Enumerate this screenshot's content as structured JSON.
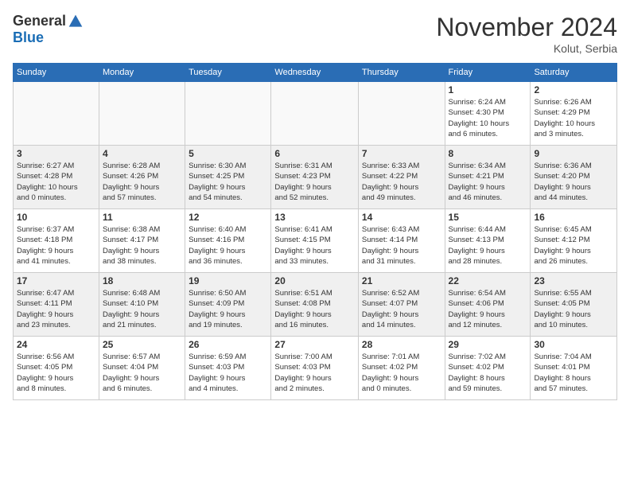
{
  "header": {
    "logo_general": "General",
    "logo_blue": "Blue",
    "month_title": "November 2024",
    "location": "Kolut, Serbia"
  },
  "weekdays": [
    "Sunday",
    "Monday",
    "Tuesday",
    "Wednesday",
    "Thursday",
    "Friday",
    "Saturday"
  ],
  "weeks": [
    {
      "alt": false,
      "days": [
        {
          "num": "",
          "info": ""
        },
        {
          "num": "",
          "info": ""
        },
        {
          "num": "",
          "info": ""
        },
        {
          "num": "",
          "info": ""
        },
        {
          "num": "",
          "info": ""
        },
        {
          "num": "1",
          "info": "Sunrise: 6:24 AM\nSunset: 4:30 PM\nDaylight: 10 hours\nand 6 minutes."
        },
        {
          "num": "2",
          "info": "Sunrise: 6:26 AM\nSunset: 4:29 PM\nDaylight: 10 hours\nand 3 minutes."
        }
      ]
    },
    {
      "alt": true,
      "days": [
        {
          "num": "3",
          "info": "Sunrise: 6:27 AM\nSunset: 4:28 PM\nDaylight: 10 hours\nand 0 minutes."
        },
        {
          "num": "4",
          "info": "Sunrise: 6:28 AM\nSunset: 4:26 PM\nDaylight: 9 hours\nand 57 minutes."
        },
        {
          "num": "5",
          "info": "Sunrise: 6:30 AM\nSunset: 4:25 PM\nDaylight: 9 hours\nand 54 minutes."
        },
        {
          "num": "6",
          "info": "Sunrise: 6:31 AM\nSunset: 4:23 PM\nDaylight: 9 hours\nand 52 minutes."
        },
        {
          "num": "7",
          "info": "Sunrise: 6:33 AM\nSunset: 4:22 PM\nDaylight: 9 hours\nand 49 minutes."
        },
        {
          "num": "8",
          "info": "Sunrise: 6:34 AM\nSunset: 4:21 PM\nDaylight: 9 hours\nand 46 minutes."
        },
        {
          "num": "9",
          "info": "Sunrise: 6:36 AM\nSunset: 4:20 PM\nDaylight: 9 hours\nand 44 minutes."
        }
      ]
    },
    {
      "alt": false,
      "days": [
        {
          "num": "10",
          "info": "Sunrise: 6:37 AM\nSunset: 4:18 PM\nDaylight: 9 hours\nand 41 minutes."
        },
        {
          "num": "11",
          "info": "Sunrise: 6:38 AM\nSunset: 4:17 PM\nDaylight: 9 hours\nand 38 minutes."
        },
        {
          "num": "12",
          "info": "Sunrise: 6:40 AM\nSunset: 4:16 PM\nDaylight: 9 hours\nand 36 minutes."
        },
        {
          "num": "13",
          "info": "Sunrise: 6:41 AM\nSunset: 4:15 PM\nDaylight: 9 hours\nand 33 minutes."
        },
        {
          "num": "14",
          "info": "Sunrise: 6:43 AM\nSunset: 4:14 PM\nDaylight: 9 hours\nand 31 minutes."
        },
        {
          "num": "15",
          "info": "Sunrise: 6:44 AM\nSunset: 4:13 PM\nDaylight: 9 hours\nand 28 minutes."
        },
        {
          "num": "16",
          "info": "Sunrise: 6:45 AM\nSunset: 4:12 PM\nDaylight: 9 hours\nand 26 minutes."
        }
      ]
    },
    {
      "alt": true,
      "days": [
        {
          "num": "17",
          "info": "Sunrise: 6:47 AM\nSunset: 4:11 PM\nDaylight: 9 hours\nand 23 minutes."
        },
        {
          "num": "18",
          "info": "Sunrise: 6:48 AM\nSunset: 4:10 PM\nDaylight: 9 hours\nand 21 minutes."
        },
        {
          "num": "19",
          "info": "Sunrise: 6:50 AM\nSunset: 4:09 PM\nDaylight: 9 hours\nand 19 minutes."
        },
        {
          "num": "20",
          "info": "Sunrise: 6:51 AM\nSunset: 4:08 PM\nDaylight: 9 hours\nand 16 minutes."
        },
        {
          "num": "21",
          "info": "Sunrise: 6:52 AM\nSunset: 4:07 PM\nDaylight: 9 hours\nand 14 minutes."
        },
        {
          "num": "22",
          "info": "Sunrise: 6:54 AM\nSunset: 4:06 PM\nDaylight: 9 hours\nand 12 minutes."
        },
        {
          "num": "23",
          "info": "Sunrise: 6:55 AM\nSunset: 4:05 PM\nDaylight: 9 hours\nand 10 minutes."
        }
      ]
    },
    {
      "alt": false,
      "days": [
        {
          "num": "24",
          "info": "Sunrise: 6:56 AM\nSunset: 4:05 PM\nDaylight: 9 hours\nand 8 minutes."
        },
        {
          "num": "25",
          "info": "Sunrise: 6:57 AM\nSunset: 4:04 PM\nDaylight: 9 hours\nand 6 minutes."
        },
        {
          "num": "26",
          "info": "Sunrise: 6:59 AM\nSunset: 4:03 PM\nDaylight: 9 hours\nand 4 minutes."
        },
        {
          "num": "27",
          "info": "Sunrise: 7:00 AM\nSunset: 4:03 PM\nDaylight: 9 hours\nand 2 minutes."
        },
        {
          "num": "28",
          "info": "Sunrise: 7:01 AM\nSunset: 4:02 PM\nDaylight: 9 hours\nand 0 minutes."
        },
        {
          "num": "29",
          "info": "Sunrise: 7:02 AM\nSunset: 4:02 PM\nDaylight: 8 hours\nand 59 minutes."
        },
        {
          "num": "30",
          "info": "Sunrise: 7:04 AM\nSunset: 4:01 PM\nDaylight: 8 hours\nand 57 minutes."
        }
      ]
    }
  ]
}
